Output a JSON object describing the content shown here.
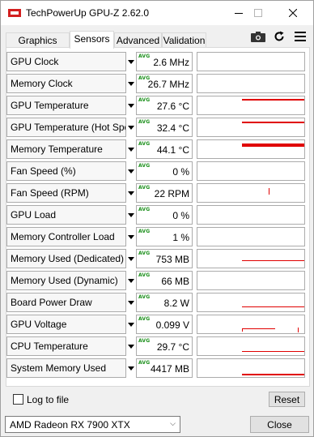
{
  "window": {
    "title": "TechPowerUp GPU-Z 2.62.0"
  },
  "tabs": [
    {
      "label": "Graphics Card",
      "active": false
    },
    {
      "label": "Sensors",
      "active": true
    },
    {
      "label": "Advanced",
      "active": false
    },
    {
      "label": "Validation",
      "active": false
    }
  ],
  "toolbar_icons": [
    "camera-icon",
    "refresh-icon",
    "menu-icon"
  ],
  "sensors": [
    {
      "name": "GPU Clock",
      "badge": "AVG",
      "value": "2.6 MHz"
    },
    {
      "name": "Memory Clock",
      "badge": "AVG",
      "value": "26.7 MHz"
    },
    {
      "name": "GPU Temperature",
      "badge": "AVG",
      "value": "27.6 °C"
    },
    {
      "name": "GPU Temperature (Hot Spot)",
      "badge": "AVG",
      "value": "32.4 °C"
    },
    {
      "name": "Memory Temperature",
      "badge": "AVG",
      "value": "44.1 °C"
    },
    {
      "name": "Fan Speed (%)",
      "badge": "AVG",
      "value": "0 %"
    },
    {
      "name": "Fan Speed (RPM)",
      "badge": "AVG",
      "value": "22 RPM"
    },
    {
      "name": "GPU Load",
      "badge": "AVG",
      "value": "0 %"
    },
    {
      "name": "Memory Controller Load",
      "badge": "AVG",
      "value": "1 %"
    },
    {
      "name": "Memory Used (Dedicated)",
      "badge": "AVG",
      "value": "753 MB"
    },
    {
      "name": "Memory Used (Dynamic)",
      "badge": "AVG",
      "value": "66 MB"
    },
    {
      "name": "Board Power Draw",
      "badge": "AVG",
      "value": "8.2 W"
    },
    {
      "name": "GPU Voltage",
      "badge": "AVG",
      "value": "0.099 V"
    },
    {
      "name": "CPU Temperature",
      "badge": "AVG",
      "value": "29.7 °C"
    },
    {
      "name": "System Memory Used",
      "badge": "AVG",
      "value": "4417 MB"
    }
  ],
  "footer": {
    "log_to_file_label": "Log to file",
    "log_to_file_checked": false,
    "reset_label": "Reset",
    "gpu_select_value": "AMD Radeon RX 7900 XTX",
    "close_label": "Close"
  },
  "colors": {
    "graph_line": "#e00000",
    "avg_badge": "#1a8f1a"
  }
}
